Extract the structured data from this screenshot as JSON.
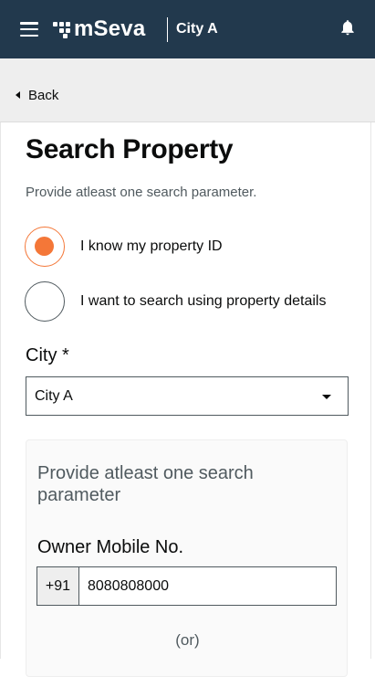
{
  "header": {
    "logo_text": "mSeva",
    "city": "City A",
    "icons": {
      "menu": "hamburger-menu-icon",
      "notifications": "bell-icon"
    }
  },
  "nav": {
    "back_label": "Back"
  },
  "page": {
    "title": "Search Property",
    "subtitle": "Provide atleast one search parameter."
  },
  "search_mode": {
    "options": [
      {
        "label": "I know my property ID",
        "selected": true
      },
      {
        "label": "I want to search using property details",
        "selected": false
      }
    ]
  },
  "city_field": {
    "label": "City *",
    "value": "City A"
  },
  "params_card": {
    "hint": "Provide atleast one search parameter",
    "owner_mobile": {
      "label": "Owner Mobile No.",
      "prefix": "+91",
      "value": "8080808000"
    },
    "separator": "(or)"
  },
  "colors": {
    "header_bg": "#22394d",
    "accent": "#f47738",
    "back_bar_bg": "#eeeeee"
  }
}
